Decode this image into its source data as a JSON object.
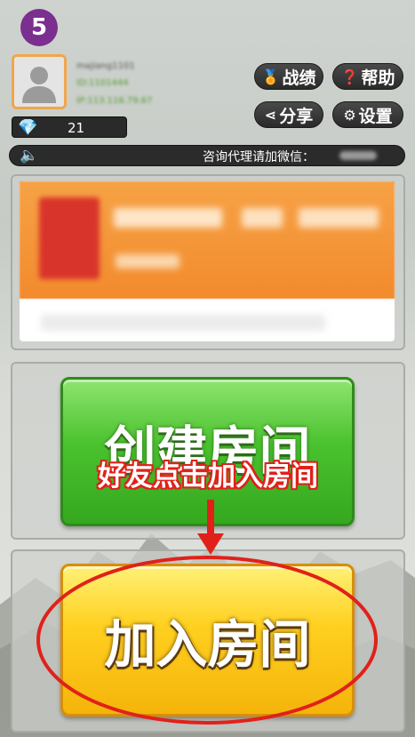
{
  "step_badge": "5",
  "profile": {
    "name": "majiang1101",
    "id": "ID:1101444",
    "ip": "IP:113.116.79.67"
  },
  "top_buttons": {
    "record": "战绩",
    "help": "帮助",
    "share": "分享",
    "settings": "设置"
  },
  "diamonds": {
    "count": "21"
  },
  "announcement": {
    "text": "咨询代理请加微信："
  },
  "main_buttons": {
    "create_room": "创建房间",
    "join_room": "加入房间"
  },
  "annotation": {
    "text": "好友点击加入房间"
  },
  "colors": {
    "create_green": "#4ac22e",
    "join_yellow": "#ffd020",
    "annotation_red": "#e0211a",
    "badge_purple": "#7b2f8e"
  }
}
